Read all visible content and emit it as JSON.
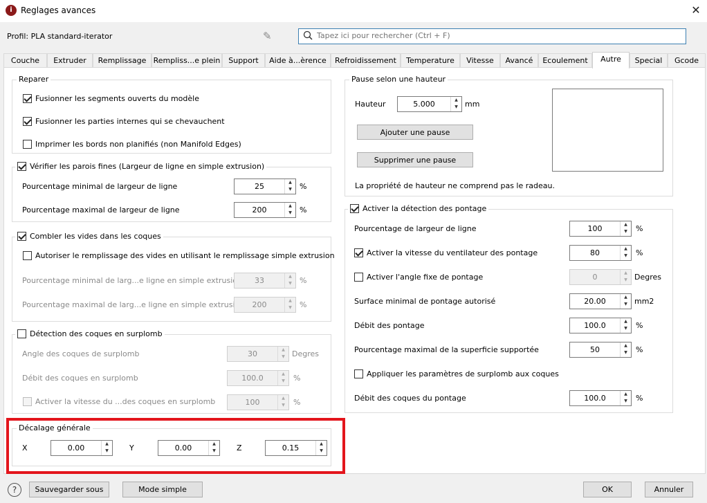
{
  "window": {
    "title": "Reglages avances",
    "close_glyph": "✕",
    "app_icon_text": "i"
  },
  "profile": {
    "label": "Profil: PLA standard-iterator"
  },
  "search": {
    "placeholder": "Tapez ici pour rechercher (Ctrl + F)"
  },
  "tabs": [
    {
      "label": "Couche"
    },
    {
      "label": "Extruder"
    },
    {
      "label": "Remplissage"
    },
    {
      "label": "Rempliss...e plein"
    },
    {
      "label": "Support"
    },
    {
      "label": "Aide à...èrence"
    },
    {
      "label": "Refroidissement"
    },
    {
      "label": "Temperature"
    },
    {
      "label": "Vitesse"
    },
    {
      "label": "Avancé"
    },
    {
      "label": "Ecoulement"
    },
    {
      "label": "Autre"
    },
    {
      "label": "Special"
    },
    {
      "label": "Gcode"
    }
  ],
  "active_tab": "Autre",
  "reparer": {
    "title": "Reparer",
    "items": [
      {
        "label": "Fusionner les segments ouverts du modèle",
        "checked": true
      },
      {
        "label": "Fusionner les parties internes qui se chevauchent",
        "checked": true
      },
      {
        "label": "Imprimer les bords non planifiés (non Manifold Edges)",
        "checked": false
      }
    ]
  },
  "parois": {
    "title": "Vérifier les parois fines (Largeur de ligne en simple extrusion)",
    "checked": true,
    "rows": [
      {
        "label": "Pourcentage minimal de largeur de ligne",
        "value": "25",
        "unit": "%"
      },
      {
        "label": "Pourcentage maximal de largeur de ligne",
        "value": "200",
        "unit": "%"
      }
    ]
  },
  "vides": {
    "title": "Combler les vides dans les coques",
    "checked": true,
    "option": {
      "label": "Autoriser le remplissage des vides en utilisant le remplissage simple extrusion",
      "checked": false
    },
    "rows": [
      {
        "label": "Pourcentage minimal de larg...e ligne en simple extrusion",
        "value": "33",
        "unit": "%"
      },
      {
        "label": "Pourcentage maximal de larg...e ligne en simple extrusion",
        "value": "200",
        "unit": "%"
      }
    ]
  },
  "surplomb": {
    "title": "Détection des coques en surplomb",
    "checked": false,
    "rows": [
      {
        "label": "Angle des coques de surplomb",
        "value": "30",
        "unit": "Degres"
      },
      {
        "label": "Débit des coques en surplomb",
        "value": "100.0",
        "unit": "%"
      },
      {
        "label": "Activer la vitesse du ...des coques en surplomb",
        "value": "100",
        "unit": "%"
      }
    ]
  },
  "decalage": {
    "title": "Décalage générale",
    "x": {
      "label": "X",
      "value": "0.00"
    },
    "y": {
      "label": "Y",
      "value": "0.00"
    },
    "z": {
      "label": "Z",
      "value": "0.15"
    }
  },
  "pause": {
    "title": "Pause selon une hauteur",
    "height_label": "Hauteur",
    "height_value": "5.000",
    "height_unit": "mm",
    "add_label": "Ajouter une pause",
    "remove_label": "Supprimer une pause",
    "note": "La propriété de hauteur ne comprend pas le radeau."
  },
  "pontage": {
    "title": "Activer la détection des pontage",
    "checked": true,
    "rows": [
      {
        "label": "Pourcentage de largeur de ligne",
        "value": "100",
        "unit": "%"
      },
      {
        "label": "Activer la vitesse du ventilateur des pontage",
        "value": "80",
        "unit": "%"
      },
      {
        "label": "Activer l'angle fixe de pontage",
        "value": "0",
        "unit": "Degres"
      },
      {
        "label": "Surface minimal de pontage autorisé",
        "value": "20.00",
        "unit": "mm2"
      },
      {
        "label": "Débit des pontage",
        "value": "100.0",
        "unit": "%"
      },
      {
        "label": "Pourcentage maximal de la superficie supportée",
        "value": "50",
        "unit": "%"
      },
      {
        "label": "Appliquer les paramètres de surplomb aux coques"
      },
      {
        "label": "Débit des coques du pontage",
        "value": "100.0",
        "unit": "%"
      }
    ]
  },
  "footer": {
    "help": "?",
    "save_as": "Sauvegarder sous",
    "simple_mode": "Mode simple",
    "ok": "OK",
    "cancel": "Annuler"
  }
}
